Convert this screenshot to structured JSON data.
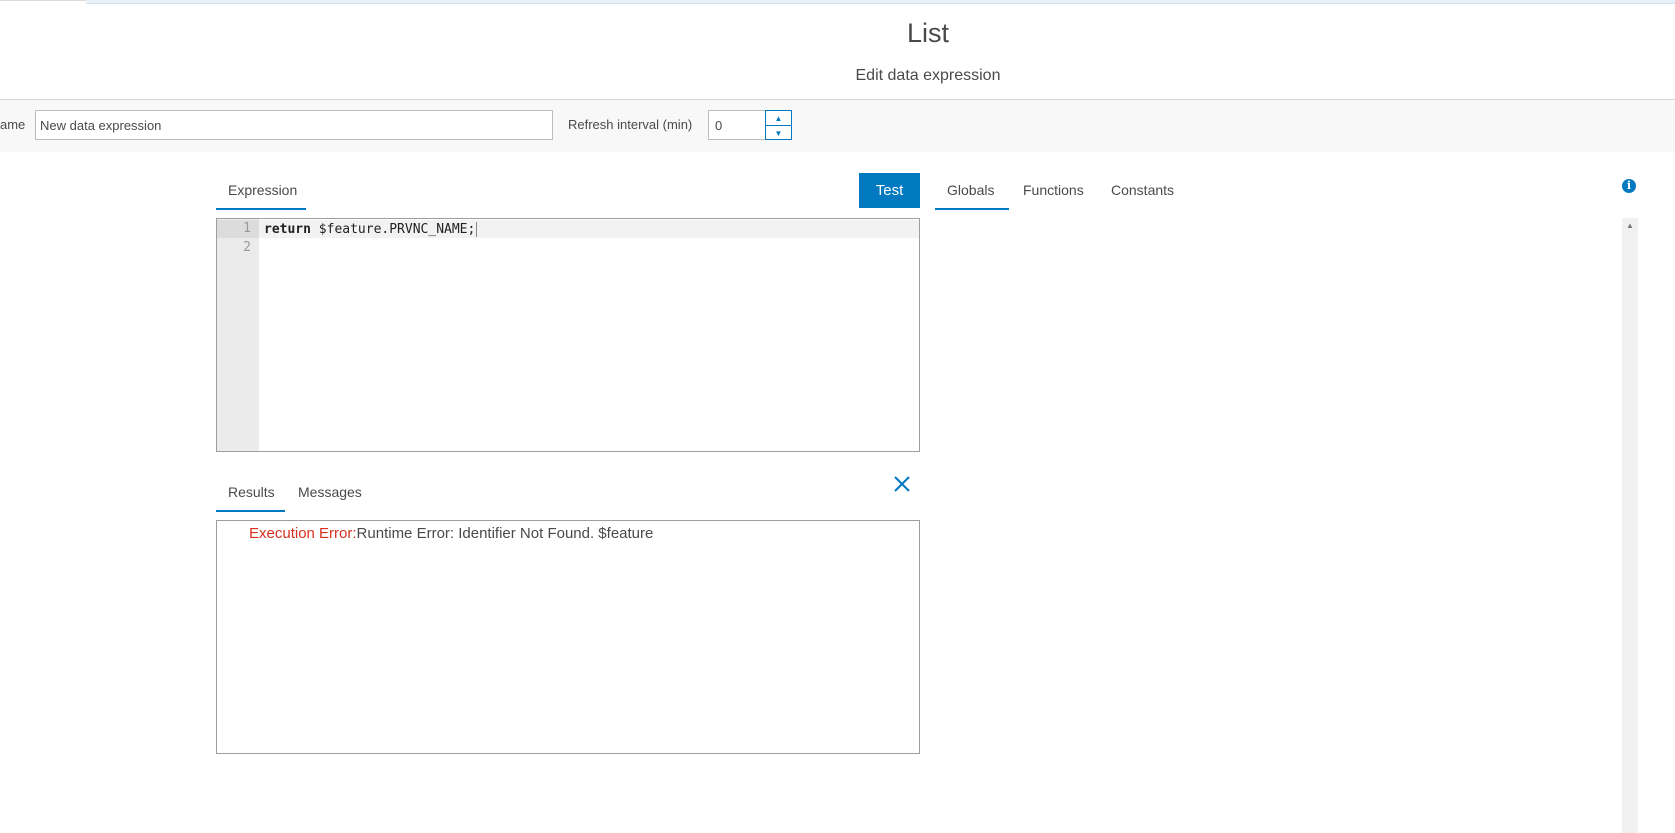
{
  "header": {
    "title": "List",
    "subtitle": "Edit data expression"
  },
  "settings": {
    "name_label": "ame",
    "name_value": "New data expression",
    "refresh_label": "Refresh interval (min)",
    "refresh_value": "0",
    "stepper_up_icon": "chevron-up-icon",
    "stepper_down_icon": "chevron-down-icon"
  },
  "editor": {
    "tab_label": "Expression",
    "test_label": "Test",
    "lines": [
      {
        "number": "1",
        "keyword": "return",
        "rest": " $feature.PRVNC_NAME;"
      },
      {
        "number": "2",
        "keyword": "",
        "rest": ""
      }
    ]
  },
  "side_panel": {
    "tabs": [
      "Globals",
      "Functions",
      "Constants"
    ],
    "active_tab": "Globals",
    "info_icon": "info-icon"
  },
  "output": {
    "tabs": [
      "Results",
      "Messages"
    ],
    "active_tab": "Results",
    "close_icon": "close-icon",
    "error_label": "Execution Error:",
    "error_message": "Runtime Error: Identifier Not Found. $feature"
  },
  "colors": {
    "accent": "#0079c1",
    "error": "#d83020"
  }
}
